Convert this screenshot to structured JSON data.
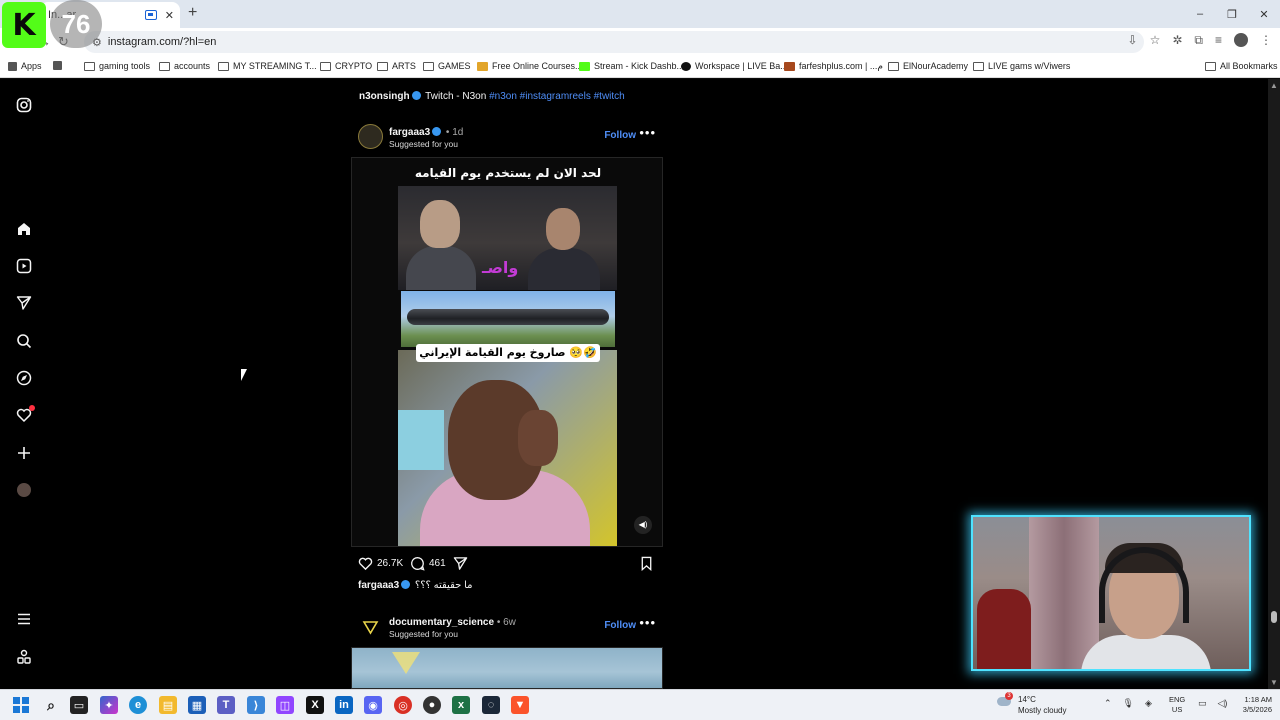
{
  "browser": {
    "tab_title": "In...ar",
    "url": "instagram.com/?hl=en",
    "new_tab_glyph": "+",
    "window_controls": [
      "–",
      "❐",
      "✕"
    ]
  },
  "overlay": {
    "kick_logo": "K",
    "viewer_count": "76"
  },
  "bookmarks": {
    "apps": "Apps",
    "items": [
      "gaming tools",
      "accounts",
      "MY STREAMING T...",
      "CRYPTO",
      "ARTS",
      "GAMES",
      "Free Online Courses...",
      "Stream - Kick Dashb...",
      "Workspace | LIVE Ba...",
      "farfeshplus.com | ...م",
      "ElNourAcademy",
      "LIVE gams w/Viwers"
    ],
    "all_bookmarks": "All Bookmarks"
  },
  "feed": {
    "prev_caption": {
      "user": "n3onsingh",
      "text": "Twitch - N3on",
      "tags": "#n3on #instagramreels #twitch"
    },
    "post1": {
      "user": "fargaaa3",
      "time": "• 1d",
      "subtitle": "Suggested for you",
      "follow": "Follow",
      "more": "•••",
      "reel_headline": "لحد الان لم يستخدم يوم القيامه",
      "reel_pill": "صاروخ يوم القيامة الإيراني 🥺🤣",
      "reel_logo": "واصـ",
      "likes": "26.7K",
      "comments": "461",
      "caption_user": "fargaaa3",
      "caption_text": "ما حقيقته ؟؟؟"
    },
    "post2": {
      "user": "documentary_science",
      "time": "• 6w",
      "subtitle": "Suggested for you",
      "follow": "Follow",
      "more": "•••"
    }
  },
  "taskbar": {
    "weather_temp": "14°C",
    "weather_desc": "Mostly cloudy",
    "weather_badge": "3",
    "lang_top": "ENG",
    "lang_bottom": "US",
    "time": "1:18 AM",
    "date": "3/5/2026"
  },
  "colors": {
    "ig_link": "#4f8ef7",
    "kick_green": "#53fc18",
    "webcam_glow": "#4fe3ff"
  }
}
